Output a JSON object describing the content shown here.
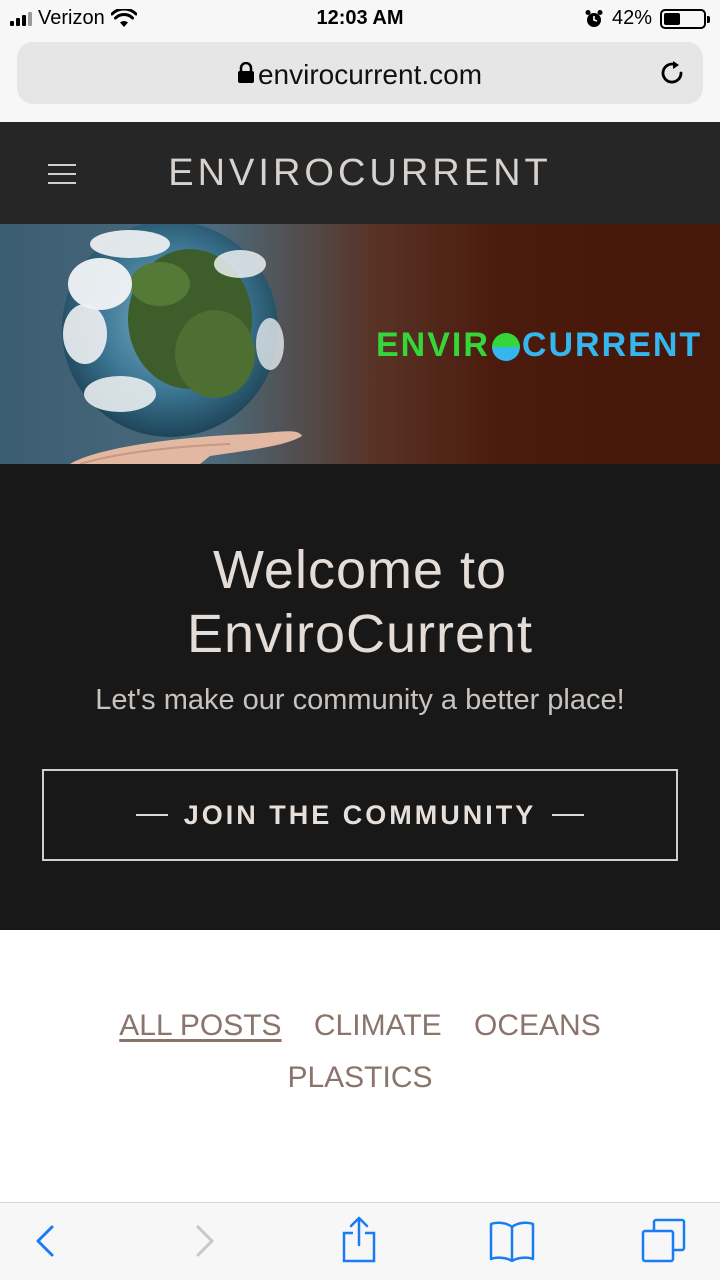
{
  "status_bar": {
    "carrier": "Verizon",
    "time": "12:03 AM",
    "battery_percent": "42%",
    "battery_level": 0.42
  },
  "browser": {
    "url": "envirocurrent.com"
  },
  "site": {
    "title": "ENVIROCURRENT",
    "banner_logo_left": "ENVIR",
    "banner_logo_right": "CURRENT"
  },
  "hero": {
    "title_line1": "Welcome to",
    "title_line2": "EnviroCurrent",
    "subtitle": "Let's make our community a better place!",
    "button_label": "JOIN THE COMMUNITY"
  },
  "categories": [
    {
      "label": "ALL POSTS",
      "active": true
    },
    {
      "label": "CLIMATE",
      "active": false
    },
    {
      "label": "OCEANS",
      "active": false
    },
    {
      "label": "PLASTICS",
      "active": false
    }
  ],
  "colors": {
    "header_bg": "#262626",
    "hero_bg": "#181818",
    "category_text": "#8a746c",
    "ios_blue": "#1a7cf5"
  }
}
